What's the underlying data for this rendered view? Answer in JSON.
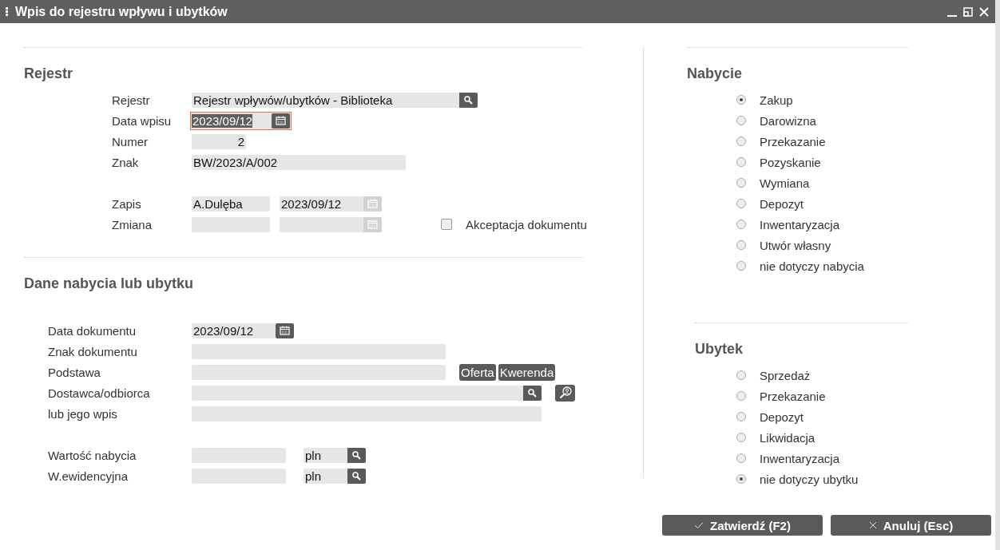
{
  "window": {
    "title": "Wpis do rejestru wpływu i ubytków"
  },
  "rejestr": {
    "heading": "Rejestr",
    "rejestr": {
      "label": "Rejestr",
      "value": "Rejestr wpływów/ubytków - Biblioteka"
    },
    "data_wpisu": {
      "label": "Data wpisu",
      "value": "2023/09/12",
      "focused": true
    },
    "numer": {
      "label": "Numer",
      "value": "2"
    },
    "znak": {
      "label": "Znak",
      "value": "BW/2023/A/002"
    },
    "zapis": {
      "label": "Zapis",
      "user": "A.Dulęba",
      "date": "2023/09/12"
    },
    "zmiana": {
      "label": "Zmiana"
    },
    "akceptacja": {
      "label": "Akceptacja dokumentu",
      "checked": false
    }
  },
  "dane": {
    "heading": "Dane nabycia lub ubytku",
    "data_dokumentu": {
      "label": "Data dokumentu",
      "value": "2023/09/12"
    },
    "znak_dokumentu": {
      "label": "Znak dokumentu"
    },
    "podstawa": {
      "label": "Podstawa",
      "buttons": [
        "Oferta",
        "Kwerenda"
      ]
    },
    "dostawca": {
      "label": "Dostawca/odbiorca"
    },
    "wpis": {
      "label": "lub jego wpis"
    },
    "wartosc": {
      "label": "Wartość nabycia",
      "currency": "pln"
    },
    "ewidencyjna": {
      "label": "W.ewidencyjna",
      "currency": "pln"
    }
  },
  "nabycie": {
    "heading": "Nabycie",
    "options": [
      {
        "label": "Zakup",
        "selected": true
      },
      {
        "label": "Darowizna",
        "selected": false
      },
      {
        "label": "Przekazanie",
        "selected": false
      },
      {
        "label": "Pozyskanie",
        "selected": false
      },
      {
        "label": "Wymiana",
        "selected": false
      },
      {
        "label": "Depozyt",
        "selected": false
      },
      {
        "label": "Inwentaryzacja",
        "selected": false
      },
      {
        "label": "Utwór własny",
        "selected": false
      },
      {
        "label": "nie dotyczy nabycia",
        "selected": false
      }
    ]
  },
  "ubytek": {
    "heading": "Ubytek",
    "options": [
      {
        "label": "Sprzedaż",
        "selected": false
      },
      {
        "label": "Przekazanie",
        "selected": false
      },
      {
        "label": "Depozyt",
        "selected": false
      },
      {
        "label": "Likwidacja",
        "selected": false
      },
      {
        "label": "Inwentaryzacja",
        "selected": false
      },
      {
        "label": "nie dotyczy ubytku",
        "selected": true
      }
    ]
  },
  "buttons": [
    {
      "label": "Zatwierdź (F2)",
      "kind": "confirm"
    },
    {
      "label": "Anuluj (Esc)",
      "kind": "cancel"
    }
  ]
}
